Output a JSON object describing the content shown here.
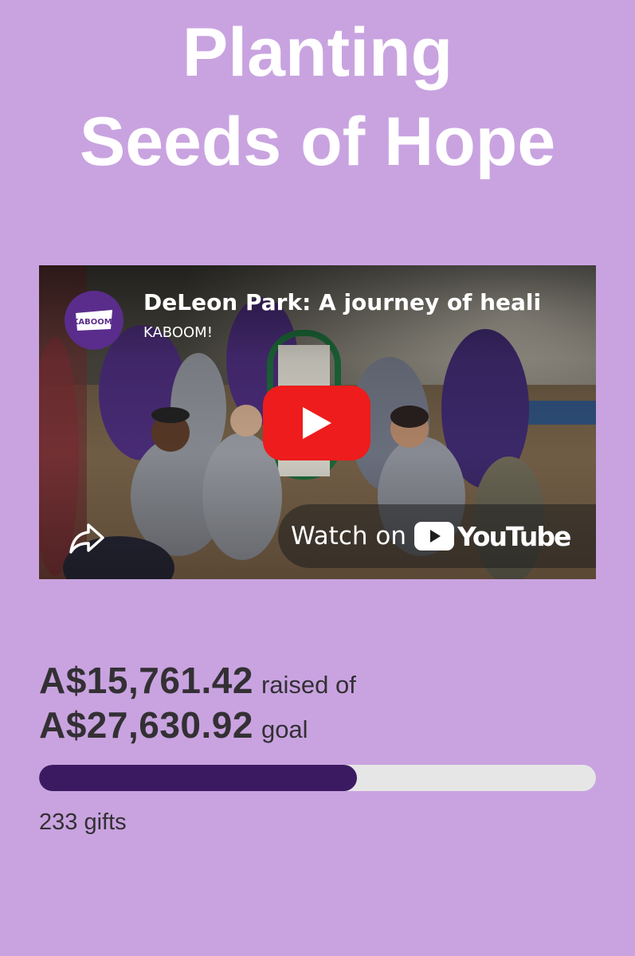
{
  "header": {
    "title_line1": "Planting",
    "title_line2": "Seeds of Hope"
  },
  "video": {
    "title": "DeLeon Park: A journey of heali",
    "channel": "KABOOM!",
    "channel_avatar_text": "KABOOM!",
    "play_icon": "play-icon",
    "share_icon": "share-arrow-icon",
    "watch_on_label": "Watch on",
    "youtube_wordmark": "YouTube",
    "colors": {
      "play_button": "#ee1c1c",
      "avatar": "#5a2d8c"
    }
  },
  "fundraising": {
    "raised": "A$15,761.42",
    "raised_suffix": "raised of",
    "goal": "A$27,630.92",
    "goal_suffix": "goal",
    "progress_fraction": 0.5704,
    "gifts": "233 gifts",
    "colors": {
      "background": "#c9a3e0",
      "progress_fill": "#3b1a62",
      "progress_track": "#e6e6e6"
    }
  }
}
